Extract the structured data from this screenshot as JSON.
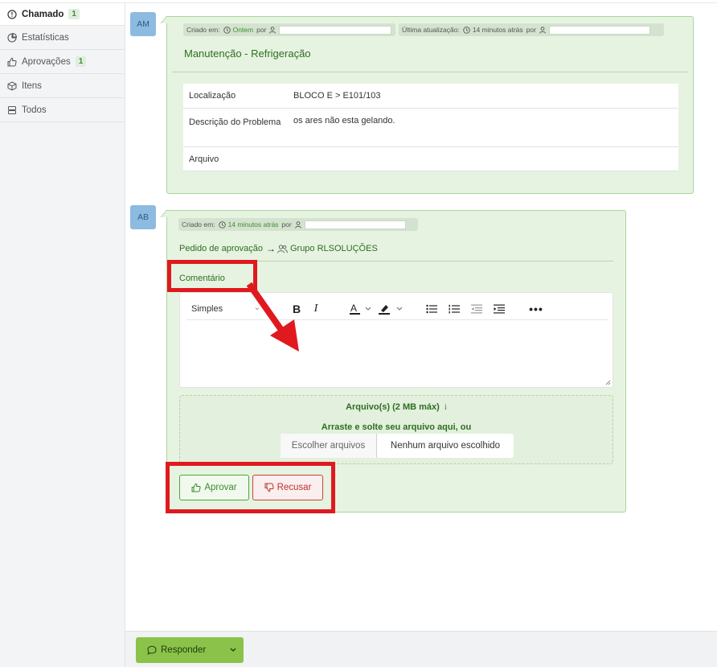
{
  "sidebar": {
    "items": [
      {
        "label": "Chamado",
        "badge": "1",
        "icon": "info-circle-icon",
        "active": true
      },
      {
        "label": "Estatísticas",
        "icon": "pie-chart-icon"
      },
      {
        "label": "Aprovações",
        "badge": "1",
        "icon": "thumbs-up-icon"
      },
      {
        "label": "Itens",
        "icon": "box-icon"
      },
      {
        "label": "Todos",
        "icon": "layers-icon"
      }
    ]
  },
  "ticket": {
    "avatar": "AM",
    "created_label": "Criado em:",
    "created_value": "Ontem",
    "by_label": "por",
    "updated_label": "Última atualização:",
    "updated_value": "14 minutos atrás",
    "updated_by_label": "por",
    "title": "Manutenção - Refrigeração",
    "fields": [
      {
        "label": "Localização",
        "value": "BLOCO E > E101/103"
      },
      {
        "label": "Descrição do Problema",
        "value": "os ares não esta gelando."
      },
      {
        "label": "Arquivo",
        "value": ""
      }
    ]
  },
  "approval": {
    "avatar": "AB",
    "created_label": "Criado em:",
    "created_value": "14 minutos atrás",
    "by_label": "por",
    "request_label": "Pedido de aprovação",
    "group": "Grupo RLSOLUÇÕES",
    "comment_label": "Comentário",
    "editor": {
      "style_select": "Simples",
      "tools": [
        "bold-icon",
        "italic-icon",
        "text-color-icon",
        "highlight-icon",
        "bullet-list-icon",
        "numbered-list-icon",
        "outdent-icon",
        "indent-icon",
        "more-icon"
      ]
    },
    "upload": {
      "title": "Arquivo(s) (2 MB máx)",
      "info": "i",
      "subtitle": "Arraste e solte seu arquivo aqui, ou",
      "choose_button": "Escolher arquivos",
      "no_file": "Nenhum arquivo escolhido"
    },
    "approve_button": "Aprovar",
    "reject_button": "Recusar"
  },
  "footer": {
    "reply_button": "Responder"
  },
  "colors": {
    "accent_green": "#8bc34a",
    "bubble_bg": "#e6f3e1",
    "annotation_red": "#e0191e",
    "reject_red": "#c03030"
  }
}
